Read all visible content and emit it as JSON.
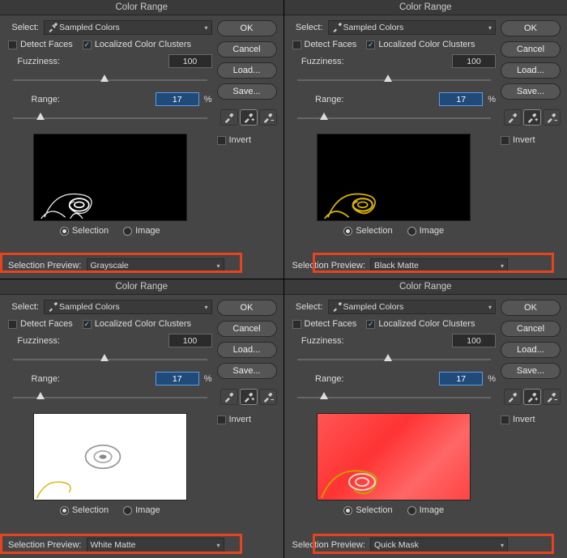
{
  "title": "Color Range",
  "labels": {
    "select": "Select:",
    "sampled_colors": "Sampled Colors",
    "detect_faces": "Detect Faces",
    "localized": "Localized Color Clusters",
    "fuzziness": "Fuzziness:",
    "range": "Range:",
    "percent": "%",
    "selection": "Selection",
    "image": "Image",
    "invert": "Invert",
    "selection_preview": "Selection Preview:"
  },
  "values": {
    "fuzziness": "100",
    "range": "17"
  },
  "buttons": {
    "ok": "OK",
    "cancel": "Cancel",
    "load": "Load...",
    "save": "Save..."
  },
  "panels": [
    {
      "preview": "Grayscale",
      "bg": "black"
    },
    {
      "preview": "Black Matte",
      "bg": "black-gold"
    },
    {
      "preview": "White Matte",
      "bg": "white"
    },
    {
      "preview": "Quick Mask",
      "bg": "red"
    }
  ]
}
